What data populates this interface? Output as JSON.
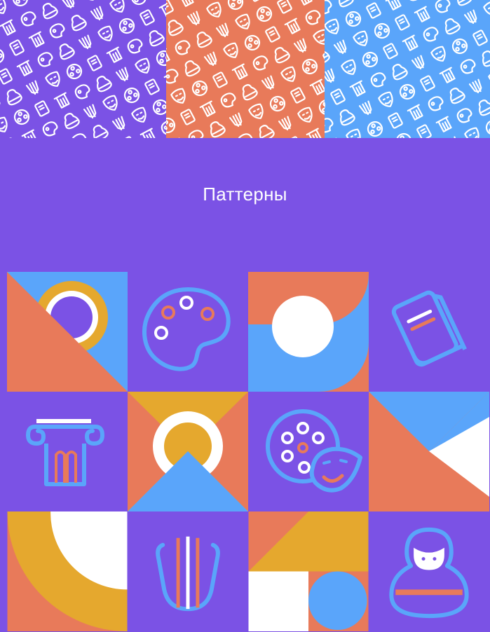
{
  "heading": "Паттерны",
  "colors": {
    "purple": "#7B52E5",
    "coral": "#E87A5A",
    "blue": "#5AA5FA",
    "yellow": "#E5A82E",
    "white": "#FFFFFF"
  },
  "pattern_strips": [
    "purple",
    "coral",
    "blue"
  ],
  "tiles": [
    {
      "icon": "ring-shape-icon"
    },
    {
      "icon": "palette-icon"
    },
    {
      "icon": "circle-shape-icon"
    },
    {
      "icon": "book-icon"
    },
    {
      "icon": "column-icon"
    },
    {
      "icon": "ring-triangles-shape-icon"
    },
    {
      "icon": "film-reel-mask-icon"
    },
    {
      "icon": "triangles-shape-icon"
    },
    {
      "icon": "arc-shape-icon"
    },
    {
      "icon": "lyre-icon"
    },
    {
      "icon": "triangles-circle-shape-icon"
    },
    {
      "icon": "matryoshka-icon"
    }
  ]
}
